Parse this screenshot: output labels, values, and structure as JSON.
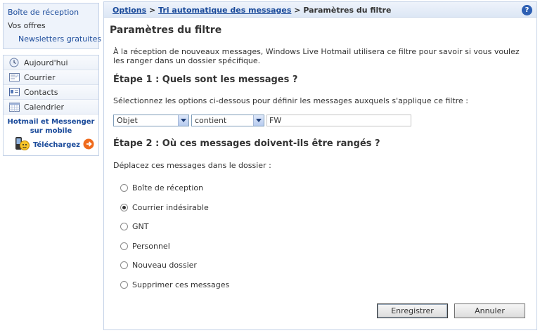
{
  "sidebar": {
    "top_links": {
      "inbox": "Boîte de réception",
      "offers": "Vos offres",
      "newsletters": "Newsletters gratuites"
    },
    "nav": [
      {
        "label": "Aujourd'hui",
        "icon": "clock-icon"
      },
      {
        "label": "Courrier",
        "icon": "mail-icon"
      },
      {
        "label": "Contacts",
        "icon": "contacts-card-icon"
      },
      {
        "label": "Calendrier",
        "icon": "calendar-icon"
      }
    ],
    "promo": {
      "line1": "Hotmail et Messenger",
      "line2": "sur mobile",
      "download": "Téléchargez"
    }
  },
  "breadcrumb": {
    "crumb1": "Options",
    "sep": ">",
    "crumb2": "Tri automatique des messages",
    "current": "Paramètres du filtre",
    "help": "?"
  },
  "main": {
    "title": "Paramètres du filtre",
    "intro": "À la réception de nouveaux messages, Windows Live Hotmail utilisera ce filtre pour savoir si vous voulez les ranger dans un dossier spécifique.",
    "step1": {
      "heading": "Étape 1 : Quels sont les messages ?",
      "description": "Sélectionnez les options ci-dessous pour définir les messages auxquels s'applique ce filtre :",
      "field_select": "Objet",
      "operator_select": "contient",
      "value": "FW"
    },
    "step2": {
      "heading": "Étape 2 : Où ces messages doivent-ils être rangés ?",
      "description": "Déplacez ces messages dans le dossier :",
      "options": [
        {
          "label": "Boîte de réception",
          "selected": false
        },
        {
          "label": "Courrier indésirable",
          "selected": true
        },
        {
          "label": "GNT",
          "selected": false
        },
        {
          "label": "Personnel",
          "selected": false
        },
        {
          "label": "Nouveau dossier",
          "selected": false
        },
        {
          "label": "Supprimer ces messages",
          "selected": false
        }
      ]
    },
    "buttons": {
      "save": "Enregistrer",
      "cancel": "Annuler"
    }
  },
  "colors": {
    "link": "#1a4a9a",
    "border": "#c5d3e8",
    "panel_bg": "#eef3fb"
  }
}
